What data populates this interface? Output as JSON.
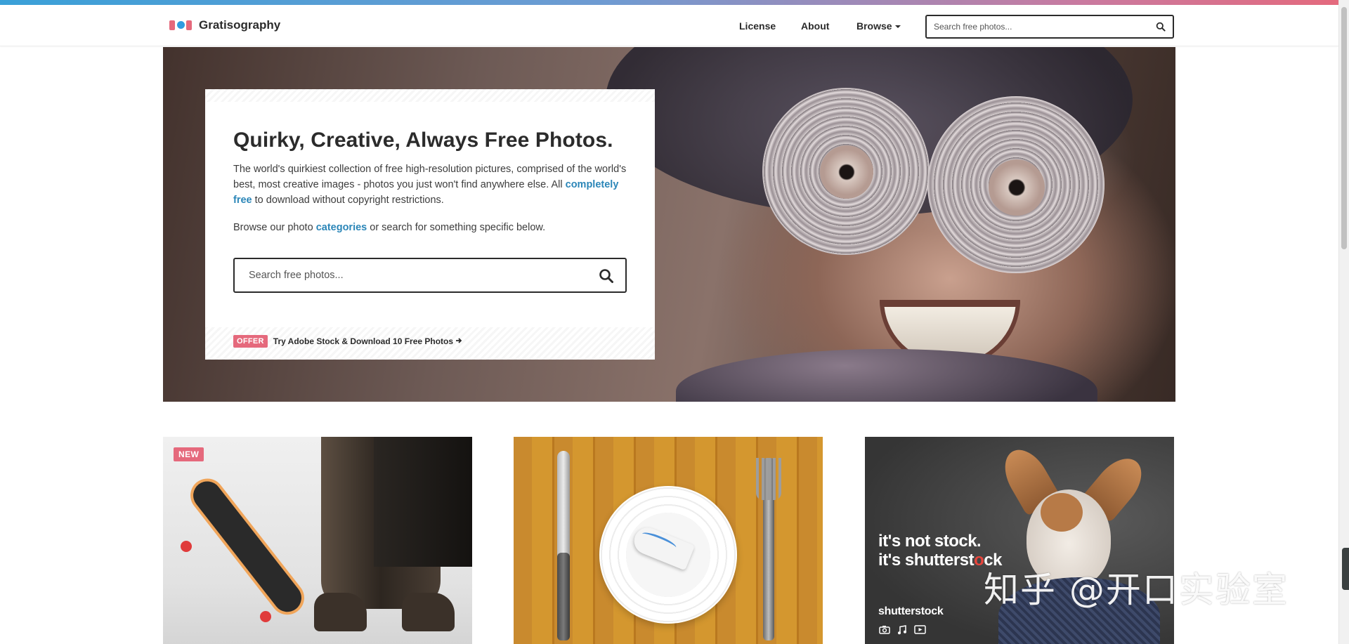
{
  "brand": {
    "name": "Gratisography",
    "accent": "#e5697c",
    "link_color": "#2b86b8"
  },
  "nav": {
    "links": [
      {
        "label": "License"
      },
      {
        "label": "About"
      },
      {
        "label": "Browse"
      }
    ],
    "search": {
      "placeholder": "Search free photos...",
      "icon": "search-icon"
    }
  },
  "hero": {
    "title": "Quirky, Creative, Always Free Photos.",
    "description_pre": "The world's quirkiest collection of free high-resolution pictures, comprised of the world's best, most creative images - photos you just won't find anywhere else. All ",
    "description_link": "completely free",
    "description_post": " to download without copyright restrictions.",
    "browse_pre": "Browse our photo ",
    "browse_link": "categories",
    "browse_post": " or search for something specific below.",
    "search": {
      "placeholder": "Search free photos...",
      "icon": "search-icon"
    },
    "offer": {
      "badge": "OFFER",
      "text": "Try Adobe Stock & Download 10 Free Photos",
      "icon": "arrow-right-icon"
    }
  },
  "tiles": [
    {
      "badge": "NEW",
      "image": "skateboard-boots-photo"
    },
    {
      "image": "plate-fish-cutlery-photo"
    },
    {
      "image": "shutterstock-dog-ad",
      "ad_line1": "it's not stock.",
      "ad_line2_pre": "it's shutterst",
      "ad_line2_accent": "o",
      "ad_line2_post": "ck",
      "ad_brand": "shutterstock",
      "ad_icons": [
        "camera-icon",
        "music-note-icon",
        "video-icon"
      ]
    }
  ],
  "watermark": "知乎 @开口实验室"
}
